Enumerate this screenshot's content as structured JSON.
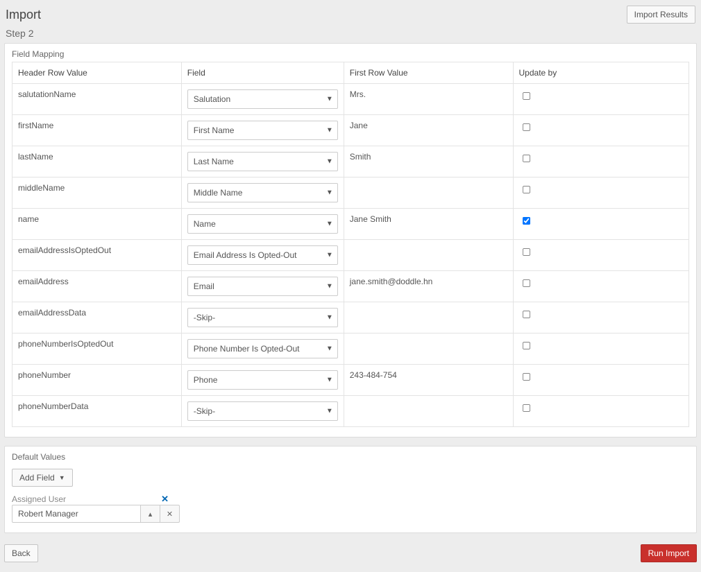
{
  "header": {
    "title": "Import",
    "import_results_label": "Import Results"
  },
  "step": "Step 2",
  "panel_field_mapping": {
    "title": "Field Mapping",
    "col_header": "Header Row Value",
    "col_field": "Field",
    "col_value": "First Row Value",
    "col_update": "Update by",
    "rows": [
      {
        "header": "salutationName",
        "field": "Salutation",
        "value": "Mrs.",
        "update": false
      },
      {
        "header": "firstName",
        "field": "First Name",
        "value": "Jane",
        "update": false
      },
      {
        "header": "lastName",
        "field": "Last Name",
        "value": "Smith",
        "update": false
      },
      {
        "header": "middleName",
        "field": "Middle Name",
        "value": "",
        "update": false
      },
      {
        "header": "name",
        "field": "Name",
        "value": "Jane Smith",
        "update": true
      },
      {
        "header": "emailAddressIsOptedOut",
        "field": "Email Address Is Opted-Out",
        "value": "",
        "update": false
      },
      {
        "header": "emailAddress",
        "field": "Email",
        "value": "jane.smith@doddle.hn",
        "update": false
      },
      {
        "header": "emailAddressData",
        "field": "-Skip-",
        "value": "",
        "update": false
      },
      {
        "header": "phoneNumberIsOptedOut",
        "field": "Phone Number Is Opted-Out",
        "value": "",
        "update": false
      },
      {
        "header": "phoneNumber",
        "field": "Phone",
        "value": "243-484-754",
        "update": false
      },
      {
        "header": "phoneNumberData",
        "field": "-Skip-",
        "value": "",
        "update": false
      }
    ]
  },
  "panel_defaults": {
    "title": "Default Values",
    "add_field_label": "Add Field",
    "assigned_user_label": "Assigned User",
    "assigned_user_value": "Robert Manager"
  },
  "footer": {
    "back_label": "Back",
    "run_label": "Run Import"
  }
}
